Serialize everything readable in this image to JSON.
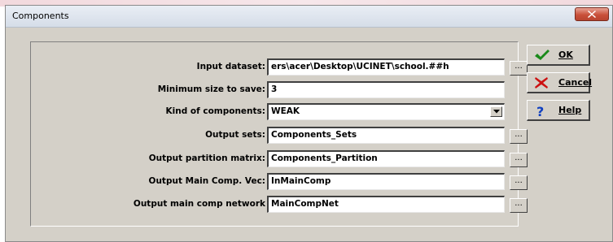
{
  "window": {
    "title": "Components"
  },
  "form": {
    "rows": [
      {
        "label": "Input dataset:",
        "value": "ers\\acer\\Desktop\\UCINET\\school.##h",
        "browse": "..."
      },
      {
        "label": "Minimum size to save:",
        "value": "3"
      },
      {
        "label": "Kind of components:",
        "value": "WEAK"
      },
      {
        "label": "Output sets:",
        "value": "Components_Sets",
        "browse": "..."
      },
      {
        "label": "Output partition matrix:",
        "value": "Components_Partition",
        "browse": "..."
      },
      {
        "label": "Output Main Comp. Vec:",
        "value": "InMainComp",
        "browse": "..."
      },
      {
        "label": "Output main comp network",
        "value": "MainCompNet",
        "browse": "..."
      }
    ]
  },
  "buttons": {
    "ok": "OK",
    "cancel": "Cancel",
    "help": "Help"
  },
  "icons": {
    "ok": "check-icon",
    "cancel": "x-icon",
    "help": "question-icon",
    "close": "close-icon",
    "dropdown": "chevron-down-icon"
  },
  "colors": {
    "dialog_bg": "#d4d0c8",
    "close_button": "#c9503a",
    "ok_check": "#1a8a1a",
    "cancel_x": "#cc1111",
    "help_q": "#1040c0"
  }
}
